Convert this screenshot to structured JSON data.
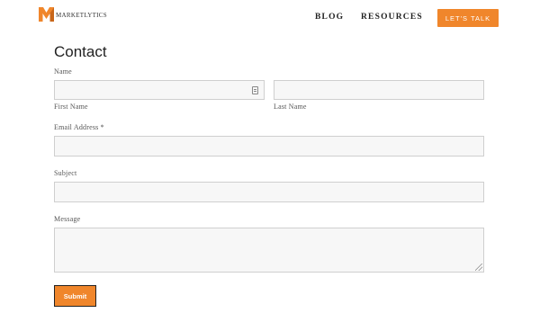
{
  "header": {
    "logo_text": "MARKETLYTICS",
    "nav": {
      "blog": "BLOG",
      "resources": "RESOURCES"
    },
    "cta_label": "LET'S TALK"
  },
  "form": {
    "title": "Contact",
    "name_label": "Name",
    "first_name_label": "First Name",
    "last_name_label": "Last Name",
    "email_label": "Email Address *",
    "subject_label": "Subject",
    "message_label": "Message",
    "submit_label": "Submit",
    "first_name_value": "",
    "last_name_value": "",
    "email_value": "",
    "subject_value": "",
    "message_value": ""
  },
  "colors": {
    "accent": "#f0862b",
    "field_bg": "#f7f7f7",
    "field_border": "#cfcfcf"
  },
  "icons": {
    "logo": "m-logo-icon",
    "autofill": "contact-card-icon",
    "resize": "resize-grip-icon"
  }
}
